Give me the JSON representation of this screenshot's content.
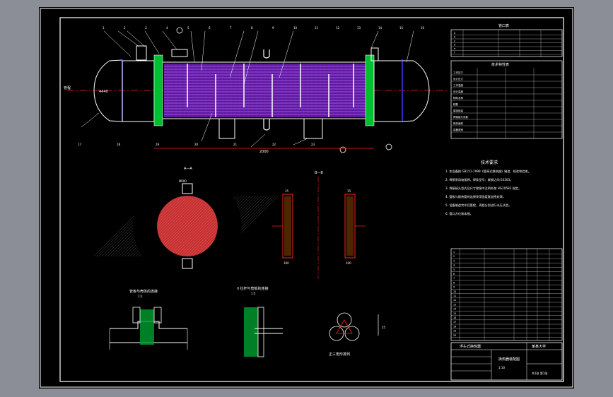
{
  "drawing": {
    "main_view": {
      "dim_top": "4440",
      "dim_bottom": "2000",
      "inlet_label": "管程",
      "section_mark": "A",
      "top_labels": [
        "1",
        "2",
        "3",
        "4",
        "5",
        "6",
        "7",
        "8",
        "9",
        "10",
        "11",
        "12",
        "13",
        "14",
        "15",
        "16"
      ],
      "bottom_labels": [
        "17",
        "18",
        "19",
        "20",
        "21",
        "22",
        "23"
      ]
    },
    "section_a": {
      "title": "A—A",
      "scale": "1:5",
      "dim": "Ø900"
    },
    "section_b": {
      "title": "B—B",
      "scale": "1:5",
      "dim_left": "15",
      "dim_right": "15",
      "dim_bot_left": "100",
      "dim_bot_right": "100"
    },
    "detail_1": {
      "title": "管板与壳体的连接",
      "scale": "1:2"
    },
    "detail_2": {
      "title": "II 拉杆与管板的连接",
      "scale": "1:5"
    },
    "detail_3": {
      "title": "正三角形排列",
      "dim": "25"
    },
    "notes_title": "技术要求",
    "notes": [
      "1. 本设备按 GB151-1999《管壳式换热器》制造、检验和验收。",
      "2. 焊接采用电弧焊，焊条型号：碳钢之间 E4303。",
      "3. 焊接接头型式及尺寸除图中注明外按 HG20583 规定。",
      "4. 管板与换热管的连接采用强度胀加密封焊。",
      "5. 设备制造完毕后管程、壳程分别进行水压试验。",
      "6. 管口方位按本图。"
    ],
    "nozzle_table_title": "管口表",
    "nozzle_rows": [
      "a",
      "b",
      "c",
      "d",
      "e",
      "f"
    ],
    "design_table_title": "技术特性表",
    "design_rows": [
      "工作压力",
      "设计压力",
      "工作温度",
      "设计温度",
      "物料名称",
      "程数",
      "腐蚀裕量",
      "焊接接头系数",
      "换热面积",
      "容器类别"
    ],
    "parts_rows": [
      "1",
      "2",
      "3",
      "4",
      "5",
      "6",
      "7",
      "8",
      "9",
      "10",
      "11",
      "12",
      "13",
      "14",
      "15",
      "16",
      "17",
      "18",
      "19",
      "20"
    ],
    "title_block": {
      "school": "某某大学",
      "drawing_name": "换热器装配图",
      "subtitle": "浮头式换热器",
      "scale": "1:10",
      "sheet": "共1张 第1张"
    }
  },
  "colors": {
    "sheet": "#000000",
    "background": "#8b8e97",
    "tube": "#b030ff",
    "baffle": "#ffffff",
    "shell": "#00d040",
    "axis": "#ff2020",
    "dim": "#3a3aff"
  }
}
